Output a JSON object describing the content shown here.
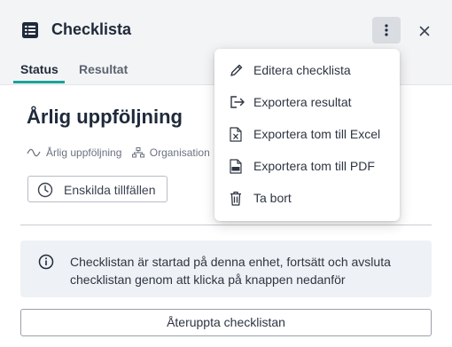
{
  "header": {
    "title": "Checklista",
    "tabs": [
      {
        "label": "Status",
        "active": true
      },
      {
        "label": "Resultat",
        "active": false
      }
    ]
  },
  "main": {
    "title": "Årlig uppföljning",
    "meta": {
      "schedule": "Årlig uppföljning",
      "organisation": "Organisation"
    },
    "occasions_button": "Enskilda tillfällen",
    "info_text": "Checklistan är startad på denna enhet, fortsätt och avsluta checklistan genom att klicka på knappen nedanför",
    "reopen_button": "Återuppta checklistan"
  },
  "menu": {
    "items": [
      {
        "label": "Editera checklista",
        "icon": "pencil-icon"
      },
      {
        "label": "Exportera resultat",
        "icon": "export-icon"
      },
      {
        "label": "Exportera tom till Excel",
        "icon": "excel-file-icon"
      },
      {
        "label": "Exportera tom till PDF",
        "icon": "pdf-file-icon"
      },
      {
        "label": "Ta bort",
        "icon": "trash-icon"
      }
    ]
  },
  "colors": {
    "accent": "#1aa39a",
    "header_bg": "#f3f4f6",
    "info_bg": "#eef1f5",
    "text": "#1f2a3a"
  }
}
